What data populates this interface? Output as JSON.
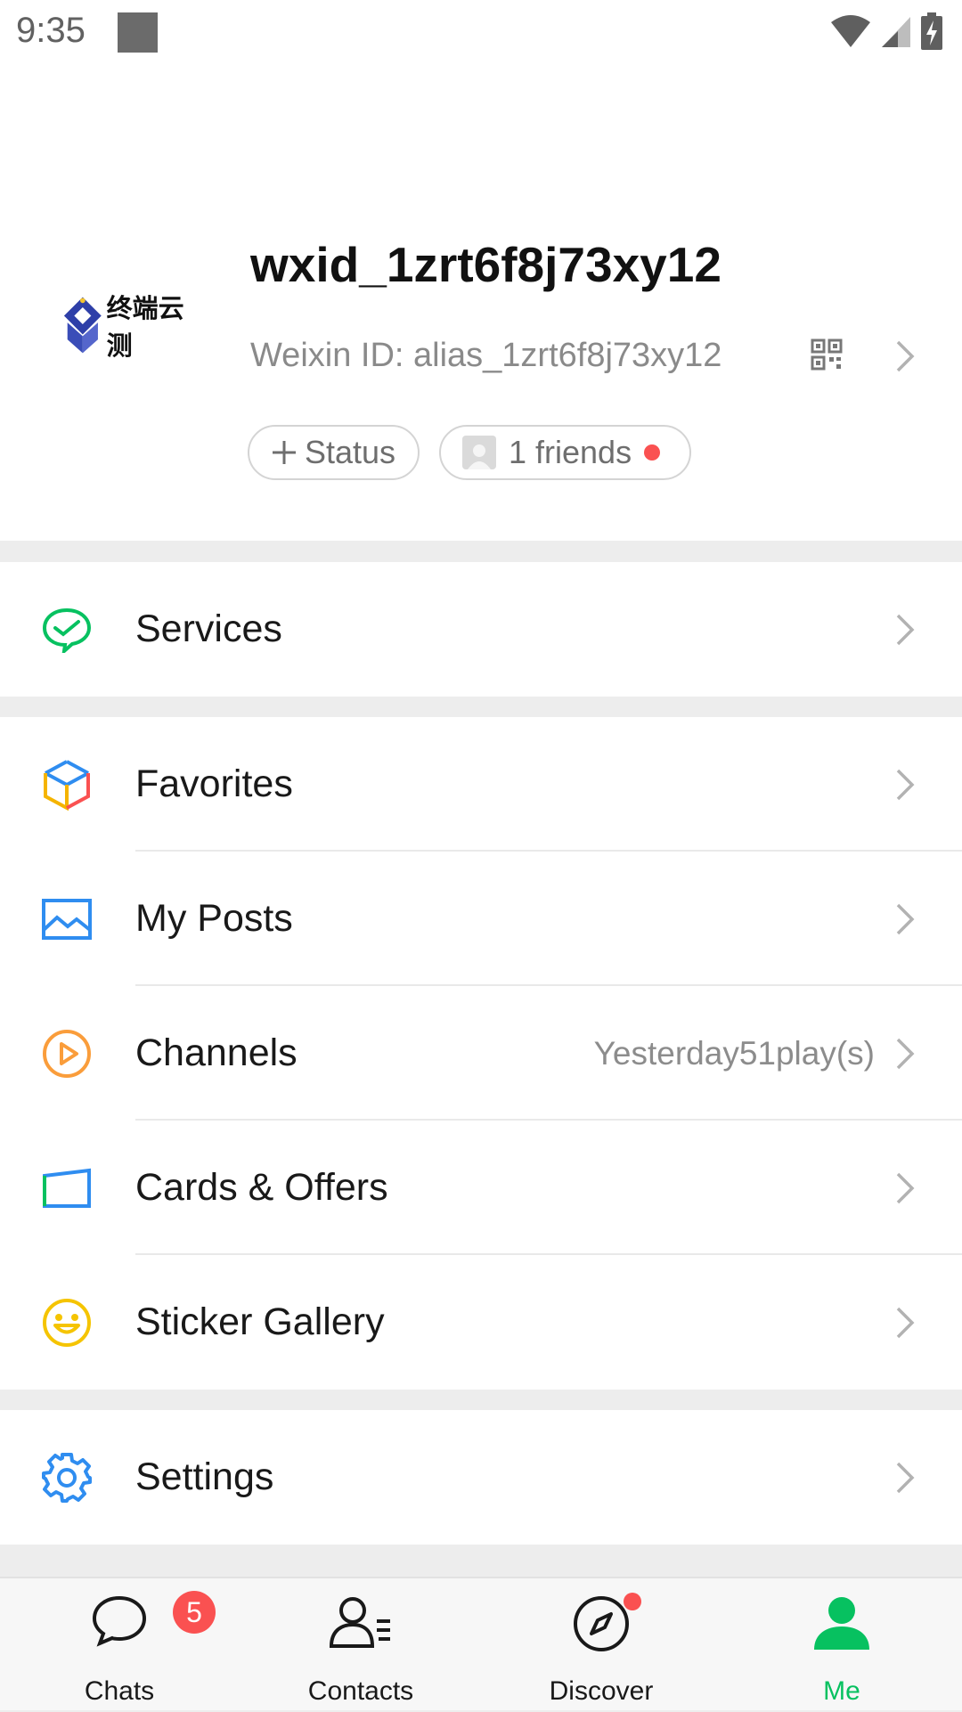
{
  "status_bar": {
    "time": "9:35"
  },
  "profile": {
    "nickname": "wxid_1zrt6f8j73xy12",
    "weixin_id": "Weixin ID: alias_1zrt6f8j73xy12",
    "status_button": "Status",
    "friends_button": "1 friends",
    "avatar_logo_text": "终端云测"
  },
  "menu": {
    "services": "Services",
    "favorites": "Favorites",
    "my_posts": "My Posts",
    "channels": "Channels",
    "channels_extra": "Yesterday51play(s)",
    "cards_offers": "Cards & Offers",
    "sticker_gallery": "Sticker Gallery",
    "settings": "Settings"
  },
  "tabs": [
    {
      "label": "Chats",
      "badge": "5",
      "icon": "chat-bubble-icon"
    },
    {
      "label": "Contacts",
      "icon": "contacts-icon"
    },
    {
      "label": "Discover",
      "icon": "compass-icon"
    },
    {
      "label": "Me",
      "icon": "person-icon",
      "active": true
    }
  ],
  "colors": {
    "accent": "#07c160",
    "badge": "#fa5151",
    "background": "#ededed"
  }
}
